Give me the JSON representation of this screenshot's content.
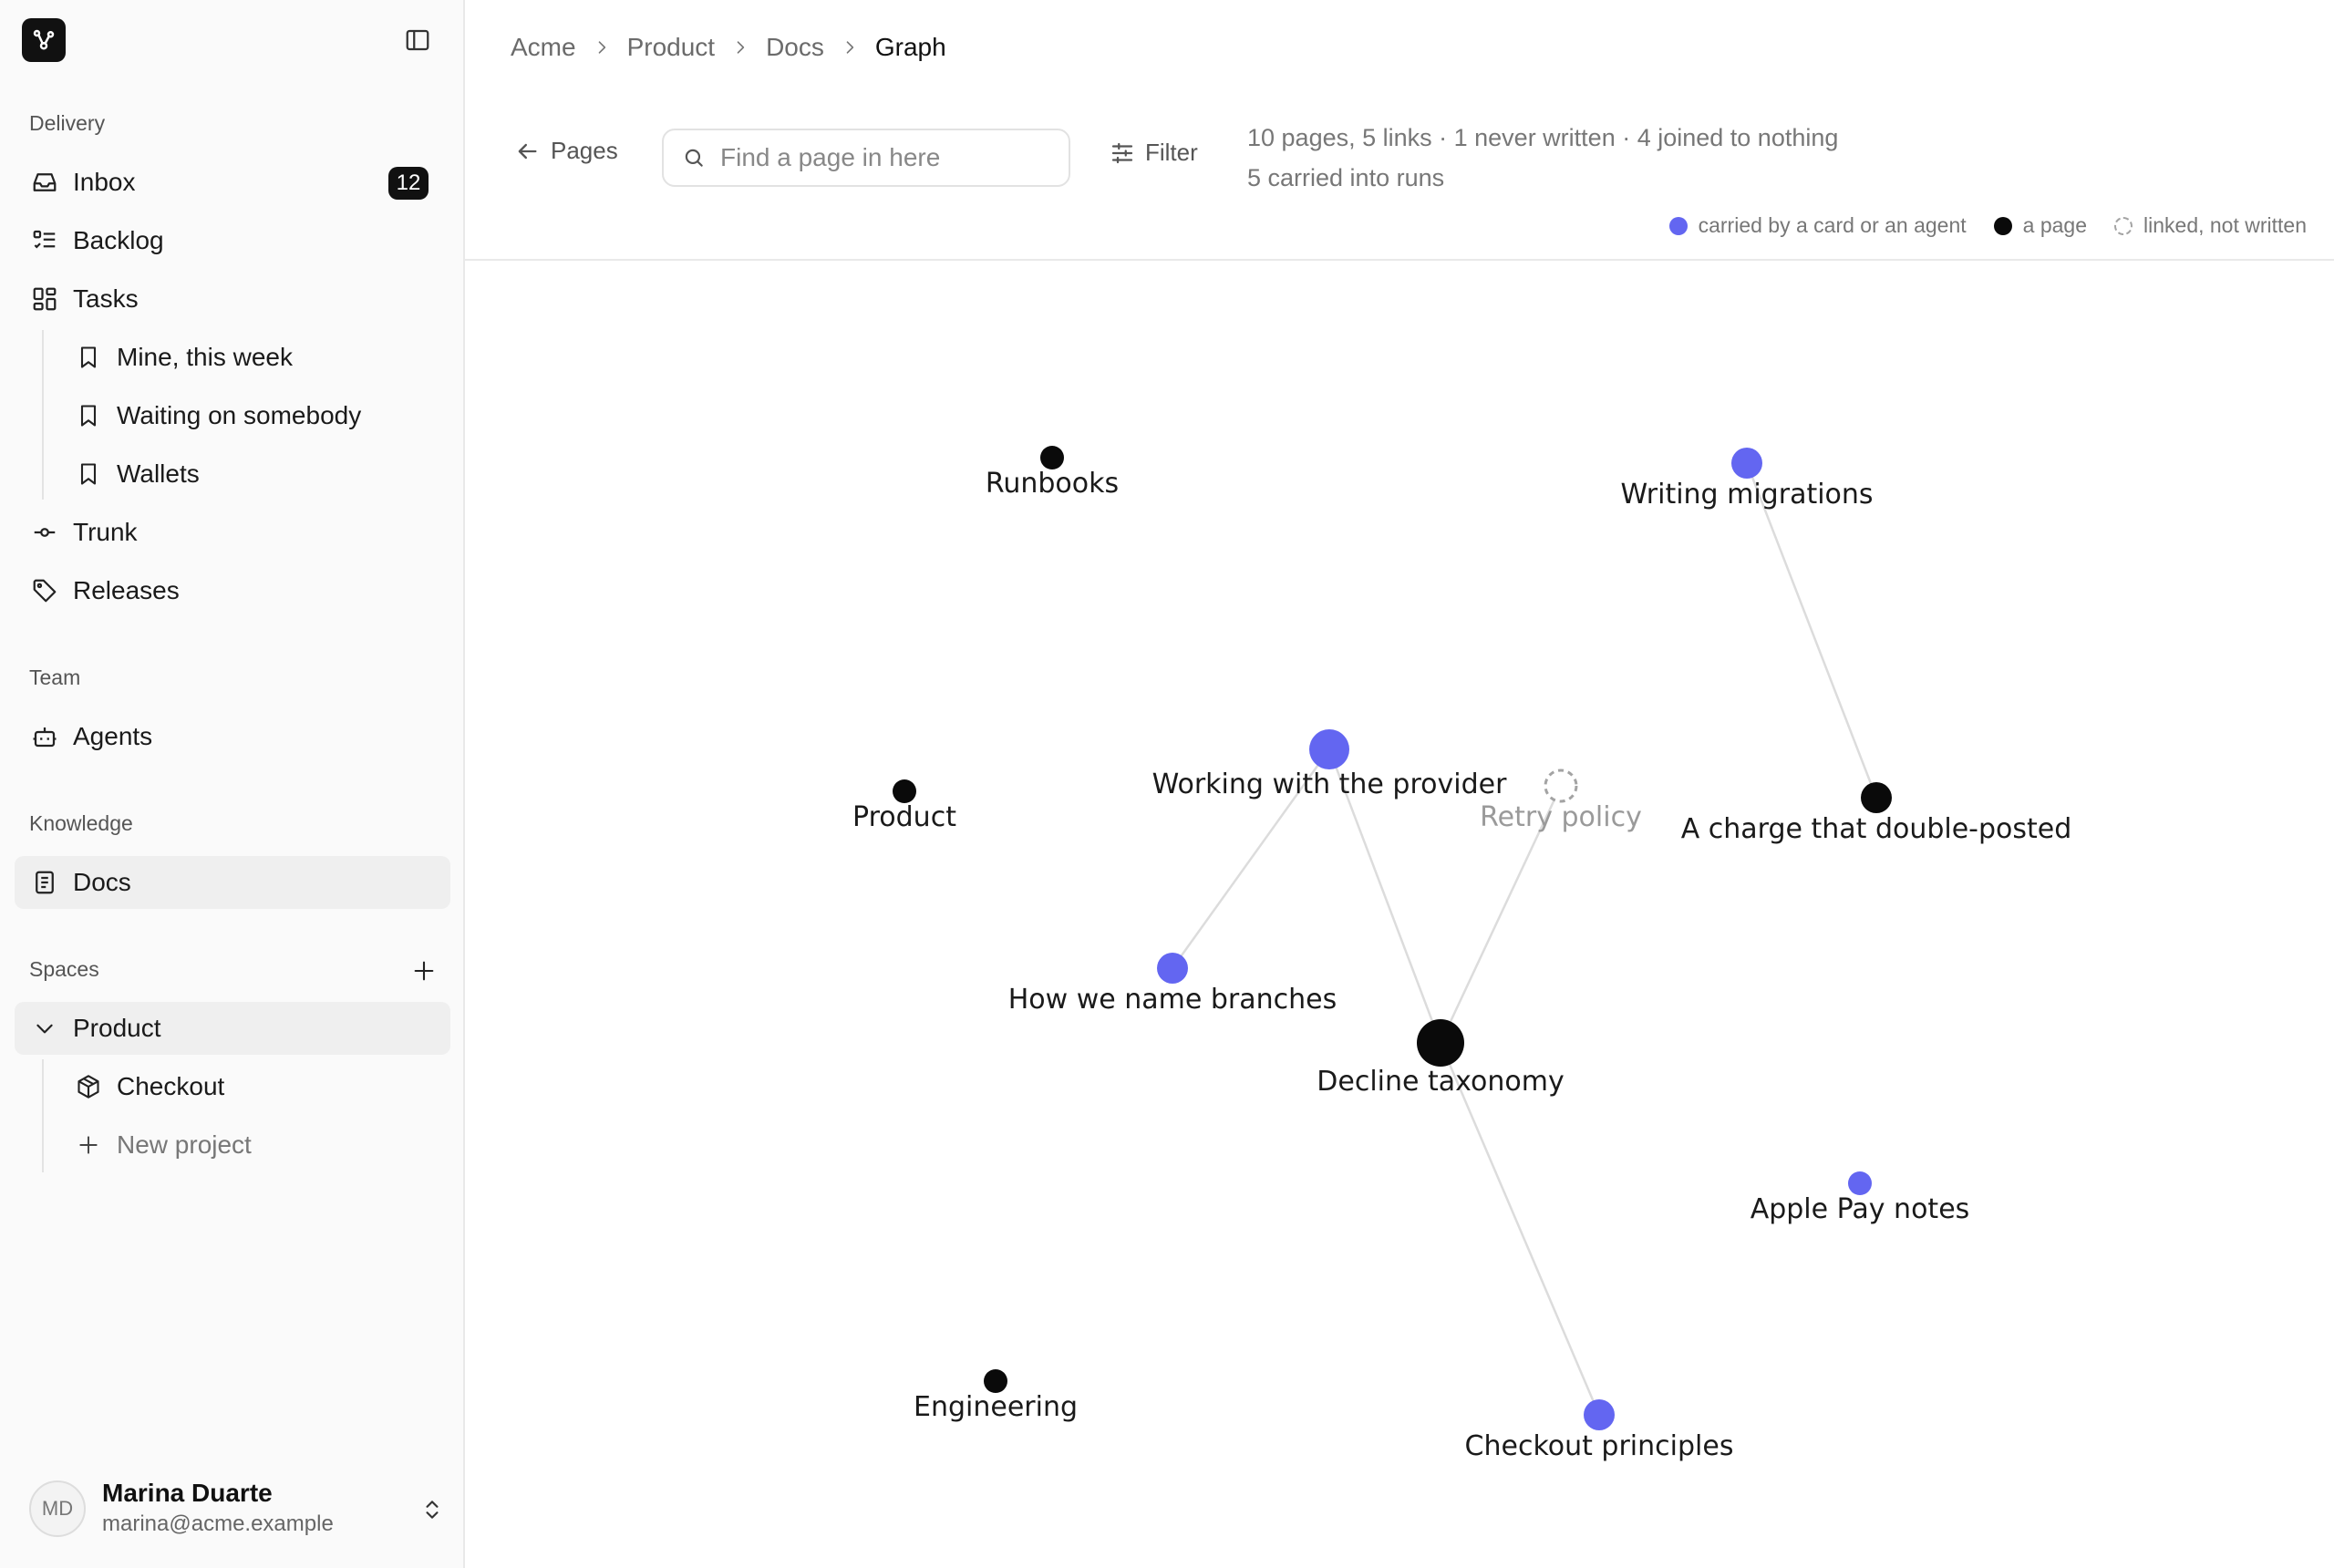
{
  "sidebar": {
    "sections": {
      "delivery": "Delivery",
      "team": "Team",
      "knowledge": "Knowledge",
      "spaces": "Spaces"
    },
    "inbox": {
      "label": "Inbox",
      "count": "12"
    },
    "backlog": "Backlog",
    "tasks": "Tasks",
    "views": [
      "Mine, this week",
      "Waiting on somebody",
      "Wallets"
    ],
    "trunk": "Trunk",
    "releases": "Releases",
    "agents": "Agents",
    "docs": "Docs",
    "space": "Product",
    "projects": [
      "Checkout"
    ],
    "new_project": "New project",
    "user": {
      "initials": "MD",
      "name": "Marina Duarte",
      "email": "marina@acme.example"
    }
  },
  "breadcrumb": [
    "Acme",
    "Product",
    "Docs",
    "Graph"
  ],
  "toolbar": {
    "back_label": "Pages",
    "search_placeholder": "Find a page in here",
    "filter_label": "Filter",
    "stats_line1": "10 pages, 5 links · 1 never written · 4 joined to nothing",
    "stats_line2": "5 carried into runs"
  },
  "legend": {
    "carried": "carried by a card or an agent",
    "page": "a page",
    "unwritten": "linked, not written"
  },
  "colors": {
    "carried": "#6366f1",
    "page": "#0a0a0a",
    "unwritten": "#a3a3a3",
    "edge": "#dcdcdc"
  },
  "graph": {
    "nodes": [
      {
        "id": "runbooks",
        "label": "Runbooks",
        "kind": "page",
        "size": "small"
      },
      {
        "id": "writing-migrations",
        "label": "Writing migrations",
        "kind": "carried",
        "size": "medium"
      },
      {
        "id": "product",
        "label": "Product",
        "kind": "page",
        "size": "small"
      },
      {
        "id": "working-with-provider",
        "label": "Working with the provider",
        "kind": "carried",
        "size": "large"
      },
      {
        "id": "retry-policy",
        "label": "Retry policy",
        "kind": "unwritten",
        "size": "medium"
      },
      {
        "id": "double-posted",
        "label": "A charge that double-posted",
        "kind": "page",
        "size": "medium"
      },
      {
        "id": "branches",
        "label": "How we name branches",
        "kind": "carried",
        "size": "medium"
      },
      {
        "id": "decline-taxonomy",
        "label": "Decline taxonomy",
        "kind": "page",
        "size": "xlarge"
      },
      {
        "id": "apple-pay",
        "label": "Apple Pay notes",
        "kind": "carried",
        "size": "small"
      },
      {
        "id": "engineering",
        "label": "Engineering",
        "kind": "page",
        "size": "small"
      },
      {
        "id": "checkout-principles",
        "label": "Checkout principles",
        "kind": "carried",
        "size": "medium"
      }
    ],
    "edges": [
      [
        "writing-migrations",
        "double-posted"
      ],
      [
        "working-with-provider",
        "branches"
      ],
      [
        "working-with-provider",
        "decline-taxonomy"
      ],
      [
        "retry-policy",
        "decline-taxonomy"
      ],
      [
        "decline-taxonomy",
        "checkout-principles"
      ]
    ]
  }
}
